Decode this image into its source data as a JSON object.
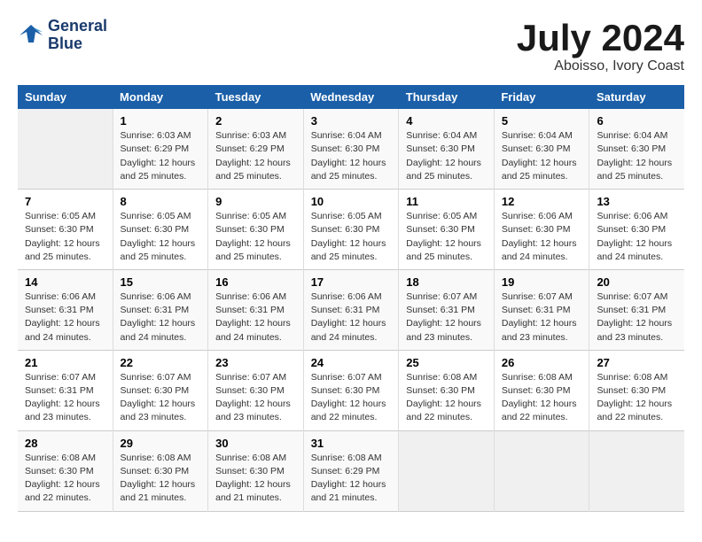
{
  "header": {
    "logo_line1": "General",
    "logo_line2": "Blue",
    "title": "July 2024",
    "subtitle": "Aboisso, Ivory Coast"
  },
  "calendar": {
    "days_of_week": [
      "Sunday",
      "Monday",
      "Tuesday",
      "Wednesday",
      "Thursday",
      "Friday",
      "Saturday"
    ],
    "weeks": [
      [
        {
          "num": "",
          "info": ""
        },
        {
          "num": "1",
          "info": "Sunrise: 6:03 AM\nSunset: 6:29 PM\nDaylight: 12 hours\nand 25 minutes."
        },
        {
          "num": "2",
          "info": "Sunrise: 6:03 AM\nSunset: 6:29 PM\nDaylight: 12 hours\nand 25 minutes."
        },
        {
          "num": "3",
          "info": "Sunrise: 6:04 AM\nSunset: 6:30 PM\nDaylight: 12 hours\nand 25 minutes."
        },
        {
          "num": "4",
          "info": "Sunrise: 6:04 AM\nSunset: 6:30 PM\nDaylight: 12 hours\nand 25 minutes."
        },
        {
          "num": "5",
          "info": "Sunrise: 6:04 AM\nSunset: 6:30 PM\nDaylight: 12 hours\nand 25 minutes."
        },
        {
          "num": "6",
          "info": "Sunrise: 6:04 AM\nSunset: 6:30 PM\nDaylight: 12 hours\nand 25 minutes."
        }
      ],
      [
        {
          "num": "7",
          "info": "Sunrise: 6:05 AM\nSunset: 6:30 PM\nDaylight: 12 hours\nand 25 minutes."
        },
        {
          "num": "8",
          "info": "Sunrise: 6:05 AM\nSunset: 6:30 PM\nDaylight: 12 hours\nand 25 minutes."
        },
        {
          "num": "9",
          "info": "Sunrise: 6:05 AM\nSunset: 6:30 PM\nDaylight: 12 hours\nand 25 minutes."
        },
        {
          "num": "10",
          "info": "Sunrise: 6:05 AM\nSunset: 6:30 PM\nDaylight: 12 hours\nand 25 minutes."
        },
        {
          "num": "11",
          "info": "Sunrise: 6:05 AM\nSunset: 6:30 PM\nDaylight: 12 hours\nand 25 minutes."
        },
        {
          "num": "12",
          "info": "Sunrise: 6:06 AM\nSunset: 6:30 PM\nDaylight: 12 hours\nand 24 minutes."
        },
        {
          "num": "13",
          "info": "Sunrise: 6:06 AM\nSunset: 6:30 PM\nDaylight: 12 hours\nand 24 minutes."
        }
      ],
      [
        {
          "num": "14",
          "info": "Sunrise: 6:06 AM\nSunset: 6:31 PM\nDaylight: 12 hours\nand 24 minutes."
        },
        {
          "num": "15",
          "info": "Sunrise: 6:06 AM\nSunset: 6:31 PM\nDaylight: 12 hours\nand 24 minutes."
        },
        {
          "num": "16",
          "info": "Sunrise: 6:06 AM\nSunset: 6:31 PM\nDaylight: 12 hours\nand 24 minutes."
        },
        {
          "num": "17",
          "info": "Sunrise: 6:06 AM\nSunset: 6:31 PM\nDaylight: 12 hours\nand 24 minutes."
        },
        {
          "num": "18",
          "info": "Sunrise: 6:07 AM\nSunset: 6:31 PM\nDaylight: 12 hours\nand 23 minutes."
        },
        {
          "num": "19",
          "info": "Sunrise: 6:07 AM\nSunset: 6:31 PM\nDaylight: 12 hours\nand 23 minutes."
        },
        {
          "num": "20",
          "info": "Sunrise: 6:07 AM\nSunset: 6:31 PM\nDaylight: 12 hours\nand 23 minutes."
        }
      ],
      [
        {
          "num": "21",
          "info": "Sunrise: 6:07 AM\nSunset: 6:31 PM\nDaylight: 12 hours\nand 23 minutes."
        },
        {
          "num": "22",
          "info": "Sunrise: 6:07 AM\nSunset: 6:30 PM\nDaylight: 12 hours\nand 23 minutes."
        },
        {
          "num": "23",
          "info": "Sunrise: 6:07 AM\nSunset: 6:30 PM\nDaylight: 12 hours\nand 23 minutes."
        },
        {
          "num": "24",
          "info": "Sunrise: 6:07 AM\nSunset: 6:30 PM\nDaylight: 12 hours\nand 22 minutes."
        },
        {
          "num": "25",
          "info": "Sunrise: 6:08 AM\nSunset: 6:30 PM\nDaylight: 12 hours\nand 22 minutes."
        },
        {
          "num": "26",
          "info": "Sunrise: 6:08 AM\nSunset: 6:30 PM\nDaylight: 12 hours\nand 22 minutes."
        },
        {
          "num": "27",
          "info": "Sunrise: 6:08 AM\nSunset: 6:30 PM\nDaylight: 12 hours\nand 22 minutes."
        }
      ],
      [
        {
          "num": "28",
          "info": "Sunrise: 6:08 AM\nSunset: 6:30 PM\nDaylight: 12 hours\nand 22 minutes."
        },
        {
          "num": "29",
          "info": "Sunrise: 6:08 AM\nSunset: 6:30 PM\nDaylight: 12 hours\nand 21 minutes."
        },
        {
          "num": "30",
          "info": "Sunrise: 6:08 AM\nSunset: 6:30 PM\nDaylight: 12 hours\nand 21 minutes."
        },
        {
          "num": "31",
          "info": "Sunrise: 6:08 AM\nSunset: 6:29 PM\nDaylight: 12 hours\nand 21 minutes."
        },
        {
          "num": "",
          "info": ""
        },
        {
          "num": "",
          "info": ""
        },
        {
          "num": "",
          "info": ""
        }
      ]
    ]
  }
}
